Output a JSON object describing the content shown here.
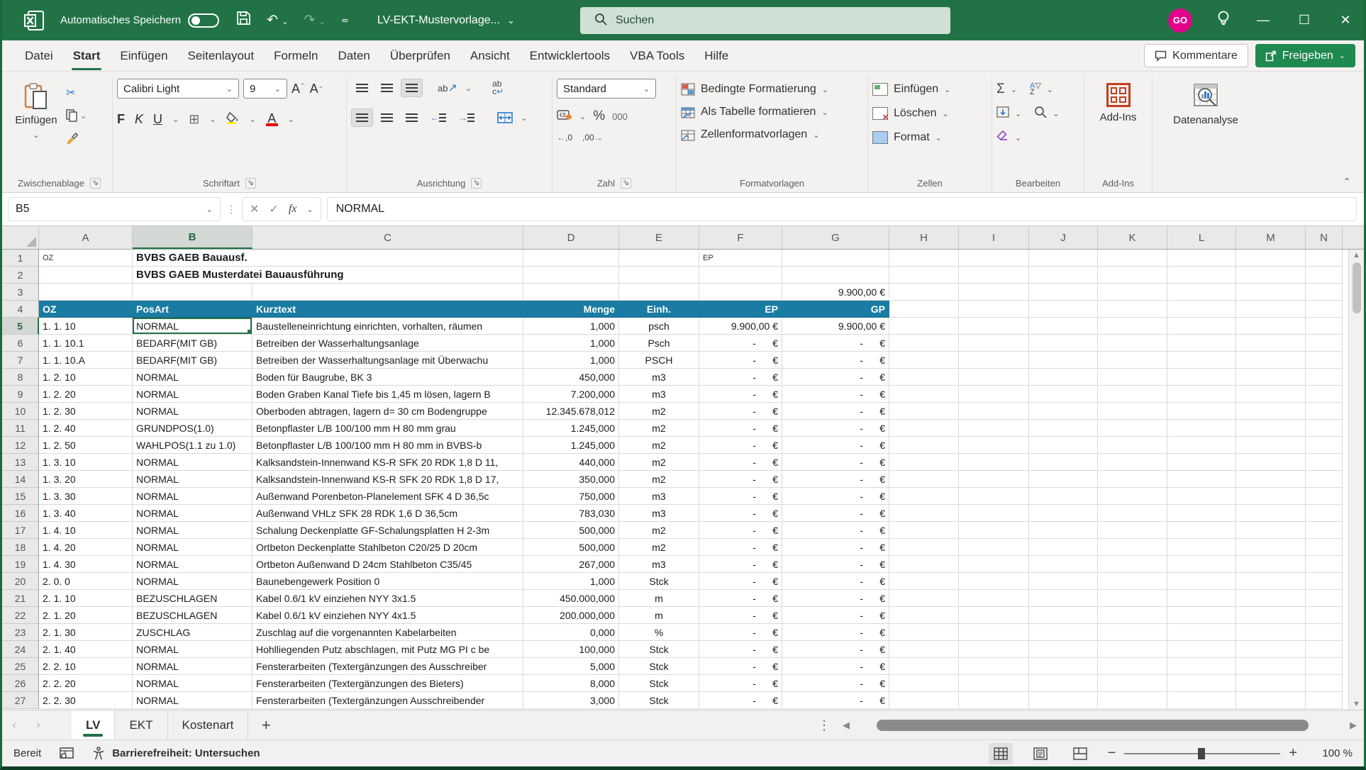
{
  "colors": {
    "title_green": "#217346",
    "accent_green": "#217346",
    "header_teal": "#1A7CA2",
    "avatar_pink": "#E3008C",
    "share_green": "#1E8A4F",
    "search_bg": "#CFE0D5"
  },
  "titlebar": {
    "autosave_label": "Automatisches Speichern",
    "document_title": "LV-EKT-Mustervorlage...",
    "search_placeholder": "Suchen",
    "avatar_initials": "GO"
  },
  "menu": {
    "tabs": [
      {
        "label": "Datei",
        "active": false
      },
      {
        "label": "Start",
        "active": true
      },
      {
        "label": "Einfügen",
        "active": false
      },
      {
        "label": "Seitenlayout",
        "active": false
      },
      {
        "label": "Formeln",
        "active": false
      },
      {
        "label": "Daten",
        "active": false
      },
      {
        "label": "Überprüfen",
        "active": false
      },
      {
        "label": "Ansicht",
        "active": false
      },
      {
        "label": "Entwicklertools",
        "active": false
      },
      {
        "label": "VBA Tools",
        "active": false
      },
      {
        "label": "Hilfe",
        "active": false
      }
    ],
    "comments_label": "Kommentare",
    "share_label": "Freigeben"
  },
  "ribbon": {
    "clipboard": {
      "paste_label": "Einfügen",
      "group_label": "Zwischenablage"
    },
    "font": {
      "name": "Calibri Light",
      "size": "9",
      "bold_label": "F",
      "italic_label": "K",
      "underline_label": "U",
      "group_label": "Schriftart"
    },
    "alignment": {
      "wrap_label": "ab",
      "group_label": "Ausrichtung"
    },
    "number": {
      "format": "Standard",
      "percent_label": "%",
      "thousands_label": "000",
      "group_label": "Zahl"
    },
    "styles": {
      "conditional_label": "Bedingte Formatierung",
      "table_label": "Als Tabelle formatieren",
      "cellstyles_label": "Zellenformatvorlagen",
      "group_label": "Formatvorlagen"
    },
    "cells": {
      "insert_label": "Einfügen",
      "delete_label": "Löschen",
      "format_label": "Format",
      "group_label": "Zellen"
    },
    "editing": {
      "group_label": "Bearbeiten"
    },
    "addins": {
      "label": "Add-Ins",
      "group_label": "Add-Ins"
    },
    "analysis": {
      "label": "Datenanalyse"
    }
  },
  "formula_bar": {
    "name_box": "B5",
    "fx_label": "fx",
    "formula": "NORMAL"
  },
  "grid": {
    "columns": [
      "A",
      "B",
      "C",
      "D",
      "E",
      "F",
      "G",
      "H",
      "I",
      "J",
      "K",
      "L",
      "M",
      "N"
    ],
    "selected_cell": "B5",
    "selected_column": "B",
    "selected_row": 5,
    "pre_rows": [
      {
        "n": 1,
        "cells": [
          {
            "col": "A",
            "text": "OZ",
            "style": "tiny"
          },
          {
            "col": "B",
            "text": "BVBS GAEB Bauausf.",
            "style": "boldover"
          },
          {
            "col": "F",
            "text": "EP",
            "style": "tiny"
          }
        ]
      },
      {
        "n": 2,
        "cells": [
          {
            "col": "B",
            "text": "BVBS GAEB Musterdatei Bauausführung",
            "style": "boldover"
          }
        ]
      },
      {
        "n": 3,
        "cells": [
          {
            "col": "G",
            "text": "9.900,00 €",
            "style": "money"
          }
        ]
      }
    ],
    "header_row": {
      "n": 4,
      "oz": "OZ",
      "posart": "PosArt",
      "kurztext": "Kurztext",
      "menge": "Menge",
      "einh": "Einh.",
      "ep": "EP",
      "gp": "GP"
    },
    "data_rows": [
      {
        "n": 5,
        "oz": "1. 1. 10",
        "posart": "NORMAL",
        "kurztext": "Baustelleneinrichtung einrichten, vorhalten, räumen",
        "menge": "1,000",
        "einh": "psch",
        "ep": "9.900,00 €",
        "gp": "9.900,00 €",
        "selected": true
      },
      {
        "n": 6,
        "oz": "1. 1. 10.1",
        "posart": "BEDARF(MIT GB)",
        "kurztext": "Betreiben der Wasserhaltungsanlage",
        "menge": "1,000",
        "einh": "Psch",
        "ep": "-      €",
        "gp": "-      €"
      },
      {
        "n": 7,
        "oz": "1. 1. 10.A",
        "posart": "BEDARF(MIT GB)",
        "kurztext": "Betreiben der Wasserhaltungsanlage mit Überwachu",
        "menge": "1,000",
        "einh": "PSCH",
        "ep": "-      €",
        "gp": "-      €"
      },
      {
        "n": 8,
        "oz": "1. 2. 10",
        "posart": "NORMAL",
        "kurztext": "Boden für Baugrube, BK 3",
        "menge": "450,000",
        "einh": "m3",
        "ep": "-      €",
        "gp": "-      €"
      },
      {
        "n": 9,
        "oz": "1. 2. 20",
        "posart": "NORMAL",
        "kurztext": "Boden Graben Kanal Tiefe bis 1,45 m lösen, lagern B",
        "menge": "7.200,000",
        "einh": "m3",
        "ep": "-      €",
        "gp": "-      €"
      },
      {
        "n": 10,
        "oz": "1. 2. 30",
        "posart": "NORMAL",
        "kurztext": "Oberboden abtragen, lagern d= 30 cm Bodengruppe",
        "menge": "12.345.678,012",
        "einh": "m2",
        "ep": "-      €",
        "gp": "-      €"
      },
      {
        "n": 11,
        "oz": "1. 2. 40",
        "posart": "GRUNDPOS(1.0)",
        "kurztext": "Betonpflaster L/B 100/100 mm H 80 mm  grau",
        "menge": "1.245,000",
        "einh": "m2",
        "ep": "-      €",
        "gp": "-      €"
      },
      {
        "n": 12,
        "oz": "1. 2. 50",
        "posart": "WAHLPOS(1.1 zu 1.0)",
        "kurztext": "Betonpflaster L/B 100/100 mm H 80 mm  in BVBS-b",
        "menge": "1.245,000",
        "einh": "m2",
        "ep": "-      €",
        "gp": "-      €"
      },
      {
        "n": 13,
        "oz": "1. 3. 10",
        "posart": "NORMAL",
        "kurztext": "Kalksandstein-Innenwand KS-R SFK 20 RDK 1,8 D 11,",
        "menge": "440,000",
        "einh": "m2",
        "ep": "-      €",
        "gp": "-      €"
      },
      {
        "n": 14,
        "oz": "1. 3. 20",
        "posart": "NORMAL",
        "kurztext": "Kalksandstein-Innenwand KS-R SFK 20 RDK 1,8 D 17,",
        "menge": "350,000",
        "einh": "m2",
        "ep": "-      €",
        "gp": "-      €"
      },
      {
        "n": 15,
        "oz": "1. 3. 30",
        "posart": "NORMAL",
        "kurztext": "Außenwand Porenbeton-Planelement SFK 4 D 36,5c",
        "menge": "750,000",
        "einh": "m3",
        "ep": "-      €",
        "gp": "-      €"
      },
      {
        "n": 16,
        "oz": "1. 3. 40",
        "posart": "NORMAL",
        "kurztext": "Außenwand VHLz SFK 28 RDK 1,6 D 36,5cm",
        "menge": "783,030",
        "einh": "m3",
        "ep": "-      €",
        "gp": "-      €"
      },
      {
        "n": 17,
        "oz": "1. 4. 10",
        "posart": "NORMAL",
        "kurztext": "Schalung Deckenplatte GF-Schalungsplatten H 2-3m",
        "menge": "500,000",
        "einh": "m2",
        "ep": "-      €",
        "gp": "-      €"
      },
      {
        "n": 18,
        "oz": "1. 4. 20",
        "posart": "NORMAL",
        "kurztext": "Ortbeton Deckenplatte Stahlbeton C20/25 D 20cm",
        "menge": "500,000",
        "einh": "m2",
        "ep": "-      €",
        "gp": "-      €"
      },
      {
        "n": 19,
        "oz": "1. 4. 30",
        "posart": "NORMAL",
        "kurztext": "Ortbeton Außenwand D 24cm Stahlbeton C35/45",
        "menge": "267,000",
        "einh": "m3",
        "ep": "-      €",
        "gp": "-      €"
      },
      {
        "n": 20,
        "oz": "2. 0.  0",
        "posart": "NORMAL",
        "kurztext": "Baunebengewerk Position 0",
        "menge": "1,000",
        "einh": "Stck",
        "ep": "-      €",
        "gp": "-      €"
      },
      {
        "n": 21,
        "oz": "2. 1. 10",
        "posart": "BEZUSCHLAGEN",
        "kurztext": "Kabel 0.6/1 kV einziehen NYY 3x1.5",
        "menge": "450.000,000",
        "einh": "m",
        "ep": "-      €",
        "gp": "-      €"
      },
      {
        "n": 22,
        "oz": "2. 1. 20",
        "posart": "BEZUSCHLAGEN",
        "kurztext": "Kabel 0.6/1 kV einziehen NYY 4x1.5",
        "menge": "200.000,000",
        "einh": "m",
        "ep": "-      €",
        "gp": "-      €"
      },
      {
        "n": 23,
        "oz": "2. 1. 30",
        "posart": "ZUSCHLAG",
        "kurztext": "Zuschlag auf die vorgenannten Kabelarbeiten",
        "menge": "0,000",
        "einh": "%",
        "ep": "-      €",
        "gp": "-      €"
      },
      {
        "n": 24,
        "oz": "2. 1. 40",
        "posart": "NORMAL",
        "kurztext": "Hohlliegenden Putz abschlagen, mit Putz MG PI c be",
        "menge": "100,000",
        "einh": "Stck",
        "ep": "-      €",
        "gp": "-      €"
      },
      {
        "n": 25,
        "oz": "2. 2. 10",
        "posart": "NORMAL",
        "kurztext": "Fensterarbeiten (Textergänzungen des Ausschreiber",
        "menge": "5,000",
        "einh": "Stck",
        "ep": "-      €",
        "gp": "-      €"
      },
      {
        "n": 26,
        "oz": "2. 2. 20",
        "posart": "NORMAL",
        "kurztext": "Fensterarbeiten (Textergänzungen des Bieters)",
        "menge": "8,000",
        "einh": "Stck",
        "ep": "-      €",
        "gp": "-      €"
      },
      {
        "n": 27,
        "oz": "2. 2. 30",
        "posart": "NORMAL",
        "kurztext": "Fensterarbeiten (Textergänzungen Ausschreibender",
        "menge": "3,000",
        "einh": "Stck",
        "ep": "-      €",
        "gp": "-      €"
      }
    ]
  },
  "sheet_bar": {
    "tabs": [
      {
        "label": "LV",
        "active": true
      },
      {
        "label": "EKT",
        "active": false
      },
      {
        "label": "Kostenart",
        "active": false
      }
    ]
  },
  "status_bar": {
    "ready": "Bereit",
    "accessibility": "Barrierefreiheit: Untersuchen",
    "zoom": "100 %"
  }
}
